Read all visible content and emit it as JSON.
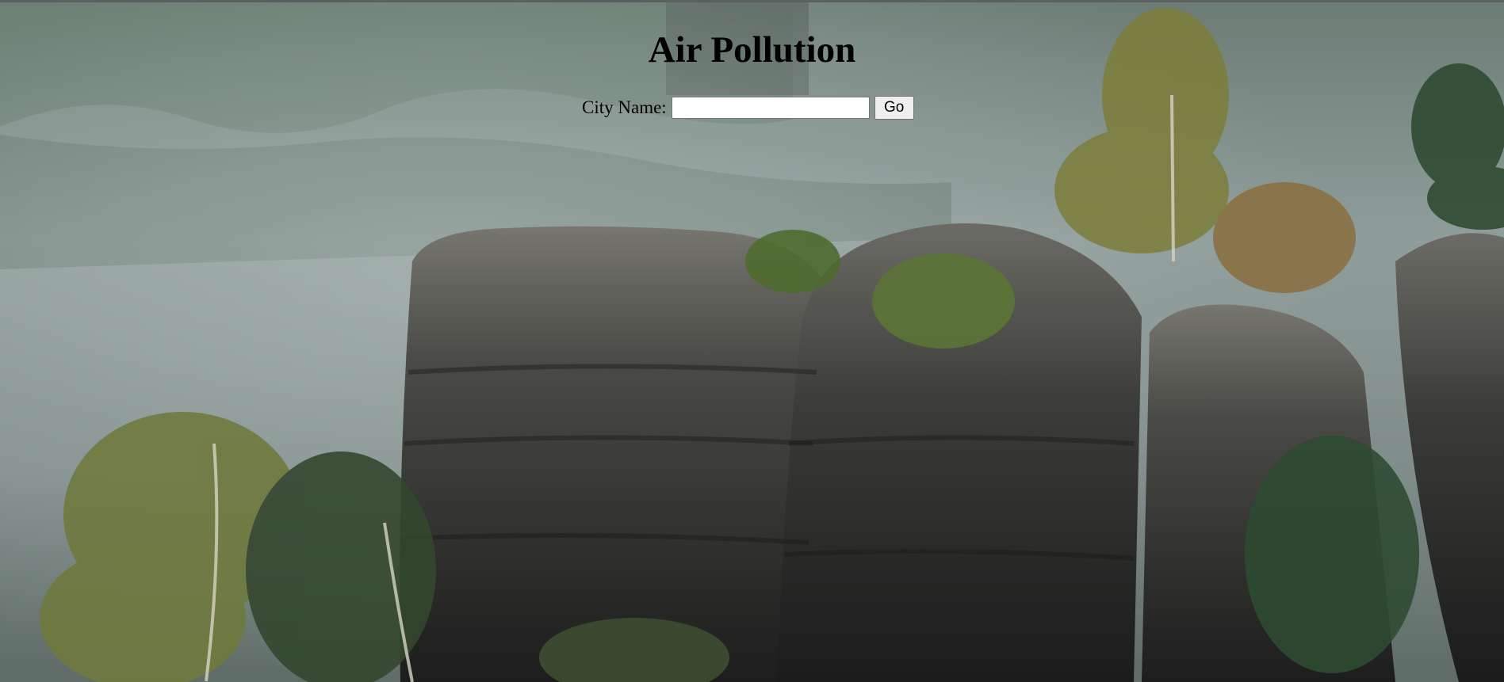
{
  "page": {
    "title": "Air Pollution"
  },
  "search_form": {
    "label": "City Name:",
    "input_value": "",
    "button_label": "Go"
  },
  "background": {
    "description_icon": "misty-rock-landscape-photo",
    "colors": {
      "fog": "#8d9b99",
      "rock": "#2b2d2c",
      "foliage": "#6f7a3e"
    }
  }
}
